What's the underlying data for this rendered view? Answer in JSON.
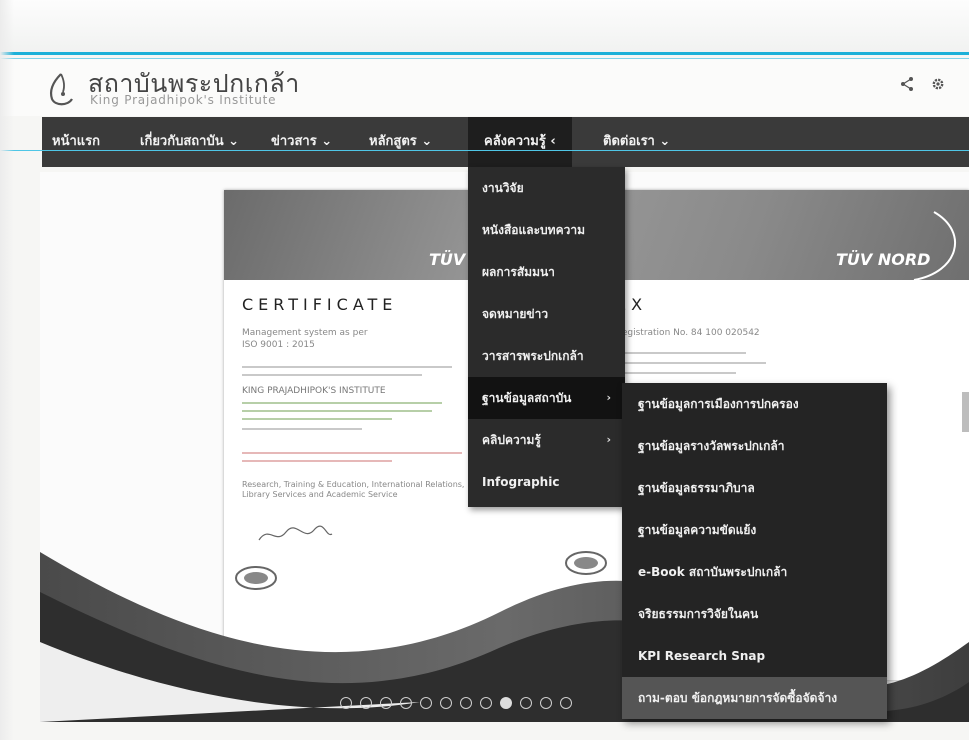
{
  "header": {
    "title": "สถาบันพระปกเกล้า",
    "subtitle": "King Prajadhipok's Institute",
    "share_icon": "share-icon",
    "settings_icon": "gear-icon"
  },
  "nav": {
    "items": [
      {
        "label": "หน้าแรก",
        "icon": ""
      },
      {
        "label": "เกี่ยวกับสถาบัน",
        "icon": "chevron-down-icon"
      },
      {
        "label": "ข่าวสาร",
        "icon": "chevron-down-icon"
      },
      {
        "label": "หลักสูตร",
        "icon": "chevron-down-icon"
      },
      {
        "label": "คลังความรู้",
        "icon": "chevron-left-icon"
      },
      {
        "label": "ติดต่อเรา",
        "icon": "chevron-down-icon"
      }
    ],
    "chevron_down": "⌄",
    "chevron_left": "‹"
  },
  "dropdown": {
    "items": [
      {
        "label": "งานวิจัย"
      },
      {
        "label": "หนังสือและบทความ"
      },
      {
        "label": "ผลการสัมมนา"
      },
      {
        "label": "จดหมายข่าว"
      },
      {
        "label": "วารสารพระปกเกล้า"
      },
      {
        "label": "ฐานข้อมูลสถาบัน",
        "arrow": "›"
      },
      {
        "label": "คลิปความรู้",
        "arrow": "›"
      },
      {
        "label": "Infographic"
      }
    ]
  },
  "submenu": {
    "items": [
      {
        "label": "ฐานข้อมูลการเมืองการปกครอง"
      },
      {
        "label": "ฐานข้อมูลรางวัลพระปกเกล้า"
      },
      {
        "label": "ฐานข้อมูลธรรมาภิบาล"
      },
      {
        "label": "ฐานข้อมูลความขัดแย้ง"
      },
      {
        "label": "e-Book สถาบันพระปกเกล้า"
      },
      {
        "label": "จริยธรรมการวิจัยในคน"
      },
      {
        "label": "KPI Research Snap"
      },
      {
        "label": "ถาม-ตอบ ข้อกฎหมายการจัดซื้อจัดจ้าง"
      }
    ]
  },
  "slide": {
    "tuv_left": "TÜV",
    "tuv_right": "TÜV NORD",
    "cert_title": "CERTIFICATE",
    "cert_annex": "EX",
    "cert_line1": "Management system as per",
    "cert_line2": "ISO 9001 : 2015",
    "cert_org": "KING PRAJADHIPOK'S INSTITUTE",
    "cert_reg": "Registration No. 84 100 020542",
    "cert_scope": "Research, Training & Education, International Relations,",
    "cert_scope2": "Library Services and Academic Service",
    "total_slides": 12,
    "active_slide": 9
  }
}
